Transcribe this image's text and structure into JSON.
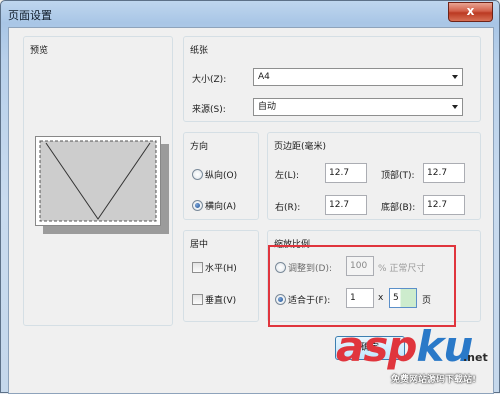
{
  "window": {
    "title": "页面设置",
    "close_glyph": "x"
  },
  "preview": {
    "title": "预览"
  },
  "paper": {
    "title": "纸张",
    "size_label": "大小(Z):",
    "size_value": "A4",
    "source_label": "来源(S):",
    "source_value": "自动"
  },
  "orientation": {
    "title": "方向",
    "portrait_label": "纵向(O)",
    "landscape_label": "横向(A)",
    "selected": "landscape"
  },
  "margins": {
    "title": "页边距(毫米)",
    "left_label": "左(L):",
    "left_value": "12.7",
    "top_label": "顶部(T):",
    "top_value": "12.7",
    "right_label": "右(R):",
    "right_value": "12.7",
    "bottom_label": "底部(B):",
    "bottom_value": "12.7"
  },
  "center": {
    "title": "居中",
    "horizontal_label": "水平(H)",
    "vertical_label": "垂直(V)"
  },
  "scaling": {
    "title": "缩放比例",
    "adjust_label": "调整到(D):",
    "adjust_value": "100",
    "adjust_suffix": "% 正常尺寸",
    "fit_label": "适合于(F):",
    "fit_pages_wide": "1",
    "fit_x": "x",
    "fit_pages_tall": "5",
    "fit_suffix": "页",
    "selected": "fit"
  },
  "ok_button": "确定",
  "watermark": {
    "brand_red": "asp",
    "brand_blue": "ku",
    "brand_dot": ".net",
    "subtitle": "免费网站源码下载站!"
  },
  "colors": {
    "highlight": "#e0353d",
    "title_bar": "#b8d0ea",
    "client_bg": "#f0f0f0"
  }
}
